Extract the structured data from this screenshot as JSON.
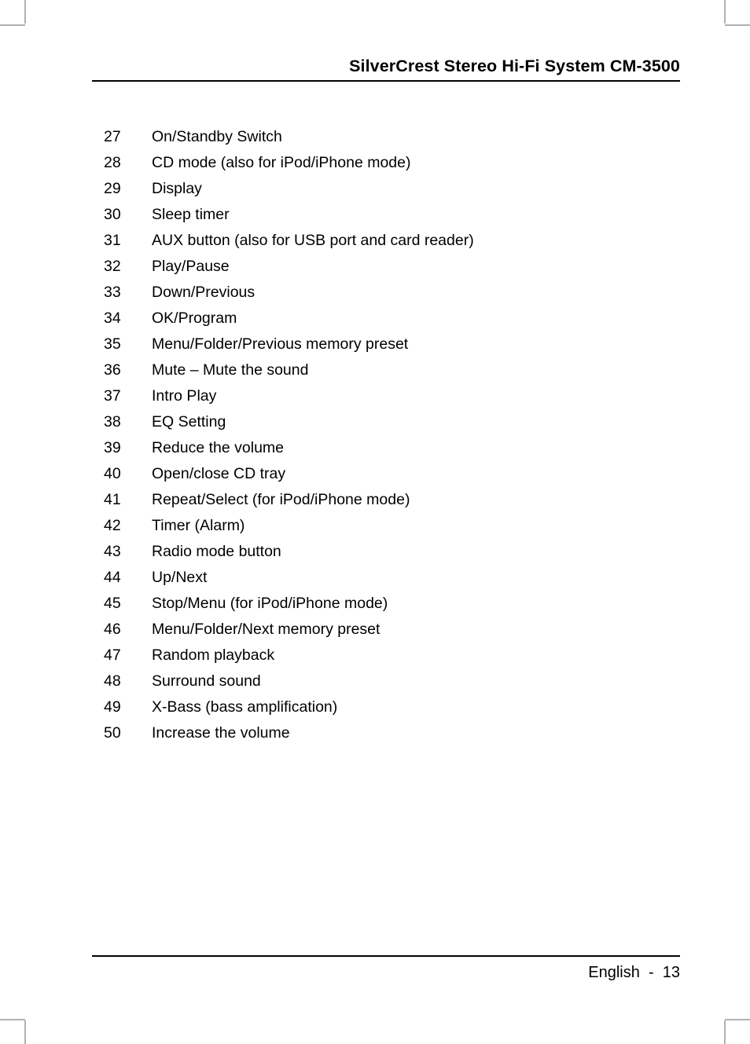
{
  "header": {
    "title": "SilverCrest Stereo Hi-Fi System CM-3500"
  },
  "main": {
    "items": [
      {
        "num": "27",
        "label": "On/Standby Switch"
      },
      {
        "num": "28",
        "label": "CD mode (also for iPod/iPhone mode)"
      },
      {
        "num": "29",
        "label": "Display"
      },
      {
        "num": "30",
        "label": "Sleep timer"
      },
      {
        "num": "31",
        "label": "AUX button (also for USB port and card reader)"
      },
      {
        "num": "32",
        "label": "Play/Pause"
      },
      {
        "num": "33",
        "label": "Down/Previous"
      },
      {
        "num": "34",
        "label": "OK/Program"
      },
      {
        "num": "35",
        "label": "Menu/Folder/Previous memory preset"
      },
      {
        "num": "36",
        "label": "Mute – Mute the sound"
      },
      {
        "num": "37",
        "label": "Intro Play"
      },
      {
        "num": "38",
        "label": "EQ Setting"
      },
      {
        "num": "39",
        "label": "Reduce the volume"
      },
      {
        "num": "40",
        "label": "Open/close CD tray"
      },
      {
        "num": "41",
        "label": "Repeat/Select (for iPod/iPhone mode)"
      },
      {
        "num": "42",
        "label": "Timer (Alarm)"
      },
      {
        "num": "43",
        "label": "Radio mode button"
      },
      {
        "num": "44",
        "label": "Up/Next"
      },
      {
        "num": "45",
        "label": "Stop/Menu (for iPod/iPhone mode)"
      },
      {
        "num": "46",
        "label": "Menu/Folder/Next memory preset"
      },
      {
        "num": "47",
        "label": "Random playback"
      },
      {
        "num": "48",
        "label": "Surround sound"
      },
      {
        "num": "49",
        "label": "X-Bass (bass amplification)"
      },
      {
        "num": "50",
        "label": "Increase the volume"
      }
    ]
  },
  "footer": {
    "text": "English  -  13",
    "language": "English",
    "page_number": "13"
  },
  "colors": {
    "text": "#000000",
    "rule": "#000000",
    "crop_mark": "#b0b0b0",
    "background": "#ffffff"
  }
}
